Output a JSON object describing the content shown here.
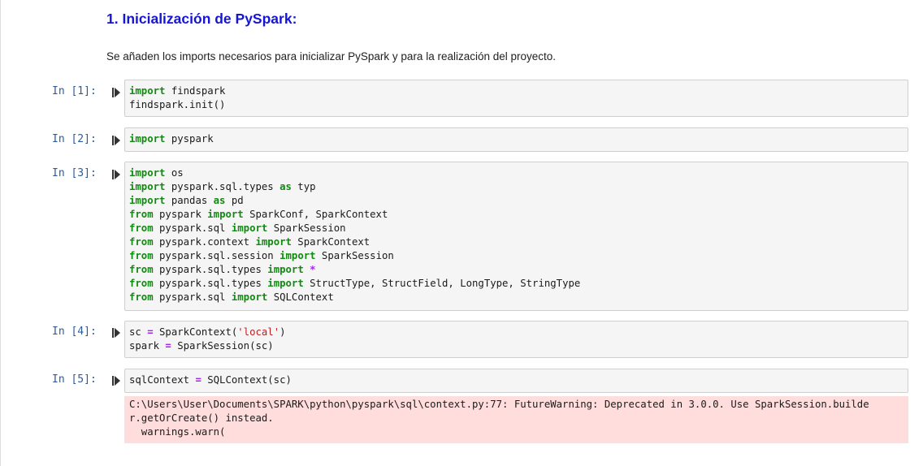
{
  "heading": "1. Inicialización de PySpark:",
  "paragraph": "Se añaden los imports necesarios para inicializar PySpark y para la realización del proyecto.",
  "cells": [
    {
      "prompt": "In [1]:",
      "lines": [
        [
          [
            "kw",
            "import"
          ],
          [
            "t",
            " findspark"
          ]
        ],
        [
          [
            "t",
            "findspark.init()"
          ]
        ]
      ]
    },
    {
      "prompt": "In [2]:",
      "lines": [
        [
          [
            "kw",
            "import"
          ],
          [
            "t",
            " pyspark"
          ]
        ]
      ]
    },
    {
      "prompt": "In [3]:",
      "lines": [
        [
          [
            "kw",
            "import"
          ],
          [
            "t",
            " os"
          ]
        ],
        [
          [
            "kw",
            "import"
          ],
          [
            "t",
            " pyspark.sql.types "
          ],
          [
            "kw",
            "as"
          ],
          [
            "t",
            " typ"
          ]
        ],
        [
          [
            "kw",
            "import"
          ],
          [
            "t",
            " pandas "
          ],
          [
            "kw",
            "as"
          ],
          [
            "t",
            " pd"
          ]
        ],
        [
          [
            "kw",
            "from"
          ],
          [
            "t",
            " pyspark "
          ],
          [
            "kw",
            "import"
          ],
          [
            "t",
            " SparkConf, SparkContext"
          ]
        ],
        [
          [
            "kw",
            "from"
          ],
          [
            "t",
            " pyspark.sql "
          ],
          [
            "kw",
            "import"
          ],
          [
            "t",
            " SparkSession"
          ]
        ],
        [
          [
            "kw",
            "from"
          ],
          [
            "t",
            " pyspark.context "
          ],
          [
            "kw",
            "import"
          ],
          [
            "t",
            " SparkContext"
          ]
        ],
        [
          [
            "kw",
            "from"
          ],
          [
            "t",
            " pyspark.sql.session "
          ],
          [
            "kw",
            "import"
          ],
          [
            "t",
            " SparkSession"
          ]
        ],
        [
          [
            "kw",
            "from"
          ],
          [
            "t",
            " pyspark.sql.types "
          ],
          [
            "kw",
            "import"
          ],
          [
            "t",
            " "
          ],
          [
            "op",
            "*"
          ]
        ],
        [
          [
            "kw",
            "from"
          ],
          [
            "t",
            " pyspark.sql.types "
          ],
          [
            "kw",
            "import"
          ],
          [
            "t",
            " StructType, StructField, LongType, StringType"
          ]
        ],
        [
          [
            "kw",
            "from"
          ],
          [
            "t",
            " pyspark.sql "
          ],
          [
            "kw",
            "import"
          ],
          [
            "t",
            " SQLContext"
          ]
        ]
      ]
    },
    {
      "prompt": "In [4]:",
      "lines": [
        [
          [
            "t",
            "sc "
          ],
          [
            "op",
            "="
          ],
          [
            "t",
            " SparkContext("
          ],
          [
            "str",
            "'local'"
          ],
          [
            "t",
            ")"
          ]
        ],
        [
          [
            "t",
            "spark "
          ],
          [
            "op",
            "="
          ],
          [
            "t",
            " SparkSession(sc)"
          ]
        ]
      ]
    },
    {
      "prompt": "In [5]:",
      "lines": [
        [
          [
            "t",
            "sqlContext "
          ],
          [
            "op",
            "="
          ],
          [
            "t",
            " SQLContext(sc)"
          ]
        ]
      ]
    }
  ],
  "stderr_output": "C:\\Users\\User\\Documents\\SPARK\\python\\pyspark\\sql\\context.py:77: FutureWarning: Deprecated in 3.0.0. Use SparkSession.builde\nr.getOrCreate() instead.\n  warnings.warn("
}
